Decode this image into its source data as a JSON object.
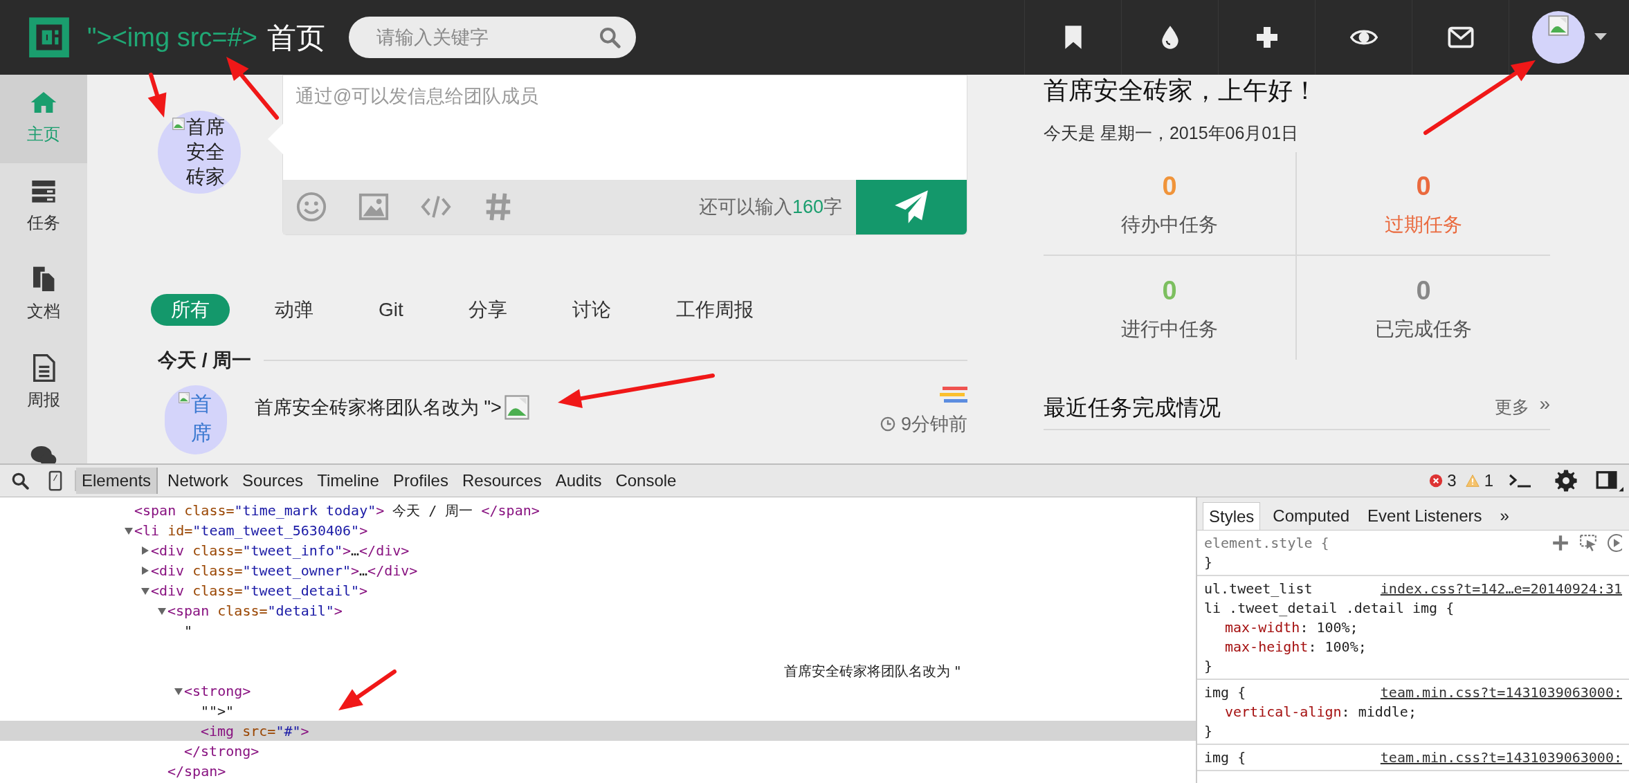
{
  "top_bar": {
    "team_name": "\"><img src=#>",
    "page_title": "首页",
    "search": {
      "placeholder": "请输入关键字"
    }
  },
  "sidebar": {
    "items": [
      {
        "kind": "home",
        "label": "主页",
        "selected": true
      },
      {
        "kind": "tasks",
        "label": "任务",
        "selected": false
      },
      {
        "kind": "docs",
        "label": "文档",
        "selected": false
      },
      {
        "kind": "report",
        "label": "周报",
        "selected": false
      },
      {
        "kind": "chat",
        "selected": false
      }
    ]
  },
  "composer": {
    "avatar_alt": "首席安全砖家",
    "placeholder": "通过@可以发信息给团队成员",
    "counter": {
      "before": "还可以输入",
      "number": "160",
      "after": "字"
    }
  },
  "filter_tabs": [
    {
      "label": "所有",
      "selected": true
    },
    {
      "label": "动弹",
      "selected": false
    },
    {
      "label": "Git",
      "selected": false
    },
    {
      "label": "分享",
      "selected": false
    },
    {
      "label": "讨论",
      "selected": false
    },
    {
      "label": "工作周报",
      "selected": false
    }
  ],
  "timeline": {
    "date_label": "今天 / 周一",
    "items": [
      {
        "avatar_alt": "首席",
        "text": "首席安全砖家将团队名改为 \">",
        "time": "9分钟前"
      }
    ]
  },
  "dashboard": {
    "greeting": "首席安全砖家，上午好！",
    "date": "今天是 星期一，2015年06月01日",
    "stats": [
      {
        "value": "0",
        "label": "待办中任务",
        "color": "#f0943a",
        "overdue": false
      },
      {
        "value": "0",
        "label": "过期任务",
        "color": "#ea6a3e",
        "overdue": true
      },
      {
        "value": "0",
        "label": "进行中任务",
        "color": "#7cbf5f",
        "overdue": false
      },
      {
        "value": "0",
        "label": "已完成任务",
        "color": "#888888",
        "overdue": false
      }
    ],
    "recent": {
      "title": "最近任务完成情况",
      "more": "更多",
      "more_glyph": "»"
    }
  },
  "devtools": {
    "tabs": [
      {
        "label": "Elements",
        "selected": true
      },
      {
        "label": "Network",
        "selected": false
      },
      {
        "label": "Sources",
        "selected": false
      },
      {
        "label": "Timeline",
        "selected": false
      },
      {
        "label": "Profiles",
        "selected": false
      },
      {
        "label": "Resources",
        "selected": false
      },
      {
        "label": "Audits",
        "selected": false
      },
      {
        "label": "Console",
        "selected": false
      }
    ],
    "errors": "3",
    "warnings": "1",
    "dom": [
      {
        "line": "<span class=\"time_mark today\"> 今天 / 周一 </span>",
        "selected": false
      },
      {
        "line": "<li id=\"team_tweet_5630406\">",
        "expanded": true,
        "selected": false,
        "children": [
          {
            "line": "<div class=\"tweet_info\">…</div>",
            "expanded": false,
            "selected": false
          },
          {
            "line": "<div class=\"tweet_owner\">…</div>",
            "expanded": false,
            "selected": false
          },
          {
            "line": "<div class=\"tweet_detail\">",
            "expanded": true,
            "selected": false,
            "children": [
              {
                "line": "<span class=\"detail\">",
                "expanded": true,
                "selected": false,
                "closing": "</span>",
                "children": [
                  {
                    "kind": "text",
                    "line": "\"",
                    "wrapped": "首席安全砖家将团队名改为 \"",
                    "selected": false
                  },
                  {
                    "line": "<strong>",
                    "expanded": true,
                    "selected": false,
                    "closing": "</strong>",
                    "children": [
                      {
                        "kind": "text",
                        "line": "\"\">\"",
                        "selected": false
                      },
                      {
                        "line": "<img src=\"#\">",
                        "selected": true
                      }
                    ]
                  }
                ]
              }
            ]
          }
        ]
      }
    ],
    "styles_tabs": [
      {
        "label": "Styles",
        "selected": true
      },
      {
        "label": "Computed",
        "selected": false
      },
      {
        "label": "Event Listeners",
        "selected": false
      },
      {
        "label": "»",
        "selected": false
      }
    ],
    "rules": [
      {
        "selector": [
          "element.style {"
        ],
        "closing": "}",
        "inline": true
      },
      {
        "selector": [
          "ul.tweet_list",
          "li .tweet_detail .detail img {"
        ],
        "source": "index.css?t=142…e=20140924:31",
        "declarations": [
          {
            "property": "max-width",
            "value": ": 100%;"
          },
          {
            "property": "max-height",
            "value": ": 100%;"
          }
        ],
        "closing": "}",
        "inline": false
      },
      {
        "selector": [
          "img {"
        ],
        "source": "team.min.css?t=1431039063000:",
        "declarations": [
          {
            "property": "vertical-align",
            "value": ": middle;"
          }
        ],
        "closing": "}",
        "inline": false
      },
      {
        "selector": [
          "img {"
        ],
        "source": "team.min.css?t=1431039063000:",
        "inline": false
      }
    ]
  }
}
